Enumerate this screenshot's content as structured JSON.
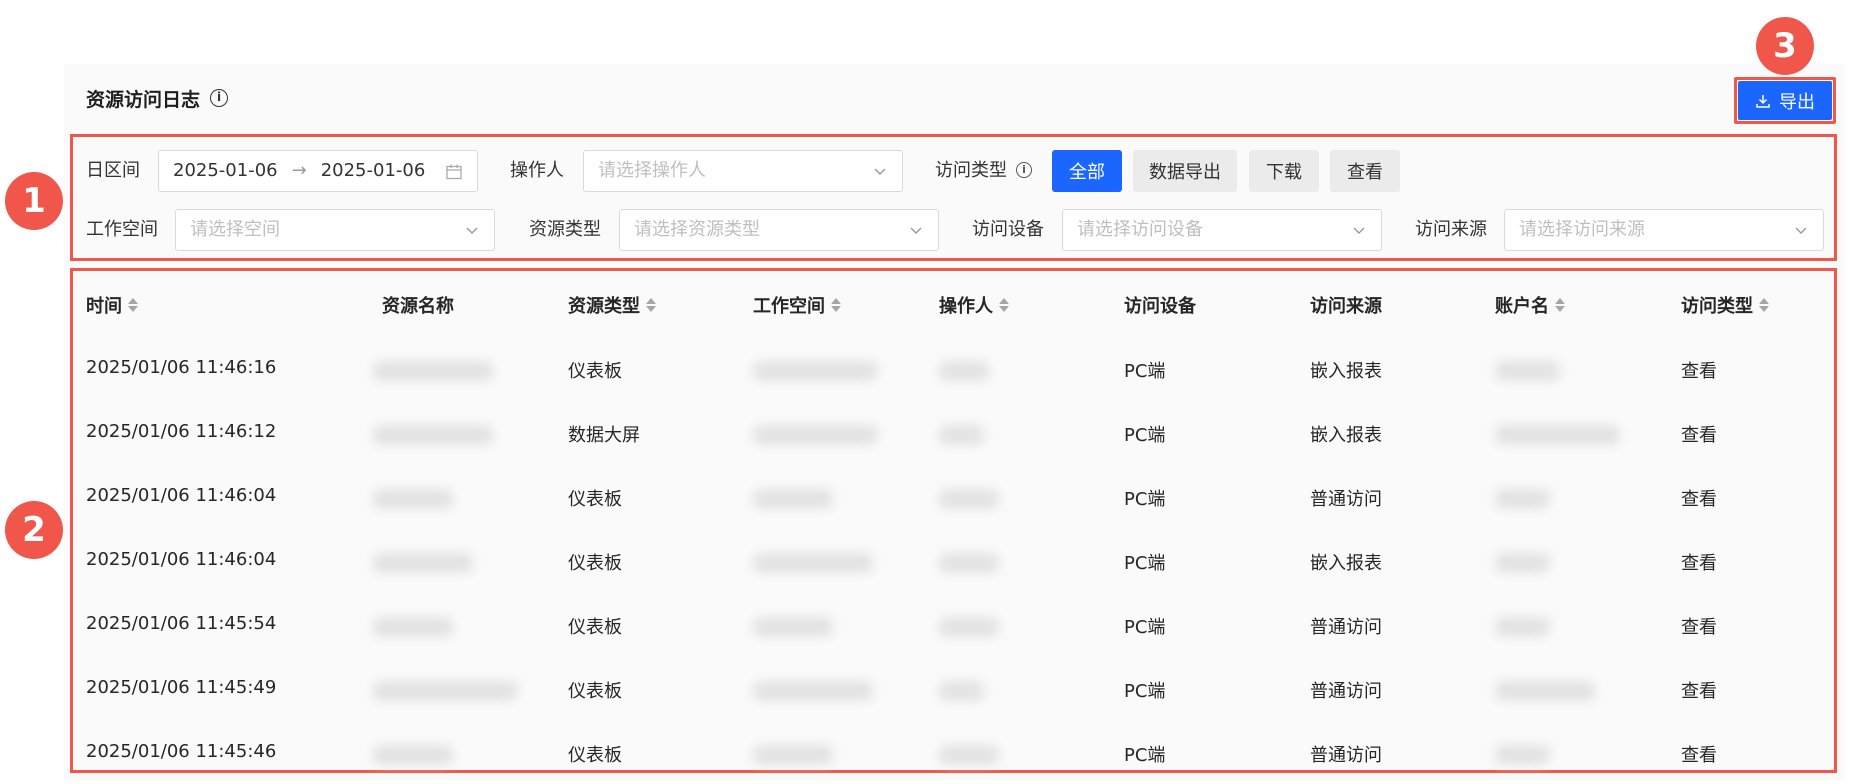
{
  "header": {
    "title": "资源访问日志",
    "info_icon": "info-icon"
  },
  "export_button": {
    "label": "导出",
    "icon": "download-icon",
    "accent": "#1a66ff"
  },
  "badges": [
    "1",
    "2",
    "3"
  ],
  "filters": {
    "date_range": {
      "label": "日区间",
      "start": "2025-01-06",
      "end": "2025-01-06",
      "separator": "→"
    },
    "operator": {
      "label": "操作人",
      "placeholder": "请选择操作人"
    },
    "access_type": {
      "label": "访问类型",
      "options": [
        "全部",
        "数据导出",
        "下载",
        "查看"
      ],
      "selected": "全部"
    },
    "workspace": {
      "label": "工作空间",
      "placeholder": "请选择空间"
    },
    "resource_type": {
      "label": "资源类型",
      "placeholder": "请选择资源类型"
    },
    "device": {
      "label": "访问设备",
      "placeholder": "请选择访问设备"
    },
    "source": {
      "label": "访问来源",
      "placeholder": "请选择访问来源"
    }
  },
  "table": {
    "columns": [
      "时间",
      "资源名称",
      "资源类型",
      "工作空间",
      "操作人",
      "访问设备",
      "访问来源",
      "账户名",
      "访问类型"
    ],
    "rows": [
      {
        "time": "2025/01/06 11:46:16",
        "resource_type": "仪表板",
        "device": "PC端",
        "source": "嵌入报表",
        "access_type": "查看"
      },
      {
        "time": "2025/01/06 11:46:12",
        "resource_type": "数据大屏",
        "device": "PC端",
        "source": "嵌入报表",
        "access_type": "查看"
      },
      {
        "time": "2025/01/06 11:46:04",
        "resource_type": "仪表板",
        "device": "PC端",
        "source": "普通访问",
        "access_type": "查看"
      },
      {
        "time": "2025/01/06 11:46:04",
        "resource_type": "仪表板",
        "device": "PC端",
        "source": "嵌入报表",
        "access_type": "查看"
      },
      {
        "time": "2025/01/06 11:45:54",
        "resource_type": "仪表板",
        "device": "PC端",
        "source": "普通访问",
        "access_type": "查看"
      },
      {
        "time": "2025/01/06 11:45:49",
        "resource_type": "仪表板",
        "device": "PC端",
        "source": "普通访问",
        "access_type": "查看"
      },
      {
        "time": "2025/01/06 11:45:46",
        "resource_type": "仪表板",
        "device": "PC端",
        "source": "普通访问",
        "access_type": "查看"
      }
    ]
  },
  "colors": {
    "annotation": "#f2574a",
    "primary": "#1a66ff"
  }
}
